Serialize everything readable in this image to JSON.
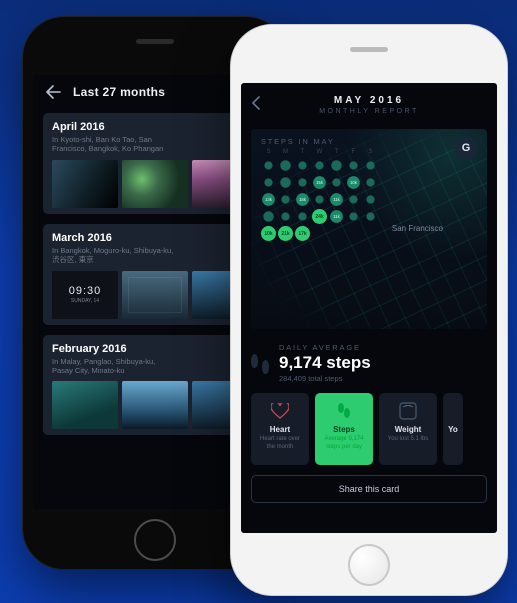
{
  "leftApp": {
    "headerTitle": "Last 27 months",
    "months": [
      {
        "title": "April 2016",
        "subtitle": "In Kyoto-shi, Ban Ko Tao, San\nFrancisco, Bangkok, Ko Phangan"
      },
      {
        "title": "March 2016",
        "subtitle": "In Bangkok, Moguro-ku, Shibuya-ku,\n渋谷区, 東京",
        "clockTime": "09:30",
        "clockDay": "SUNDAY, 14"
      },
      {
        "title": "February 2016",
        "subtitle": "In Malay, Panglao, Shibuya-ku,\nPasay City, Minato-ku"
      }
    ]
  },
  "rightApp": {
    "headerTitle": "MAY 2016",
    "headerSubtitle": "MONTHLY REPORT",
    "avatarInitial": "G",
    "stepsSectionLabel": "STEPS IN MAY",
    "daysOfWeek": [
      "S",
      "M",
      "T",
      "W",
      "T",
      "F",
      "S"
    ],
    "bubbleLabels": {
      "r2c4": "15k",
      "r2c6": "10k",
      "r3c1": "13k",
      "r3c3": "18k",
      "r3c5": "11k",
      "r4c4": "24k",
      "r4c5": "11k",
      "r5c1": "10k",
      "r5c2": "21k",
      "r5c3": "17k"
    },
    "cityLabel": "San Francisco",
    "dailyAverage": {
      "label": "DAILY AVERAGE",
      "value": "9,174 steps",
      "subtitle": "284,409 total steps"
    },
    "tiles": [
      {
        "id": "heart",
        "title": "Heart",
        "subtitle": "Heart rate over the month"
      },
      {
        "id": "steps",
        "title": "Steps",
        "subtitle": "Average 9,174 steps per day"
      },
      {
        "id": "weight",
        "title": "Weight",
        "subtitle": "You lost 5.1 lbs"
      },
      {
        "id": "more",
        "title": "Yo",
        "subtitle": ""
      }
    ],
    "shareLabel": "Share this card"
  }
}
